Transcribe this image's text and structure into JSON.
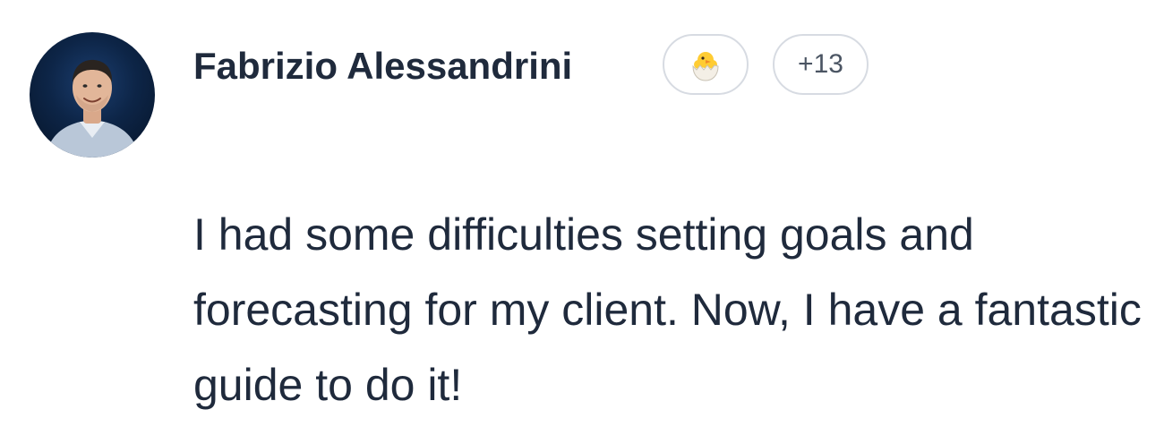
{
  "comment": {
    "author": {
      "name": "Fabrizio Alessandrini",
      "avatar_icon": "user-photo-avatar"
    },
    "badge": {
      "icon": "hatching-chick-icon"
    },
    "reactions_count": "+13",
    "text": "I had some difficulties setting goals and forecasting for my client. Now, I have a fantastic guide to do it!"
  },
  "colors": {
    "text": "#1f2a3c",
    "pill_border": "#d7dbe2",
    "count_text": "#4b5563",
    "avatar_bg": "#0d2547"
  }
}
